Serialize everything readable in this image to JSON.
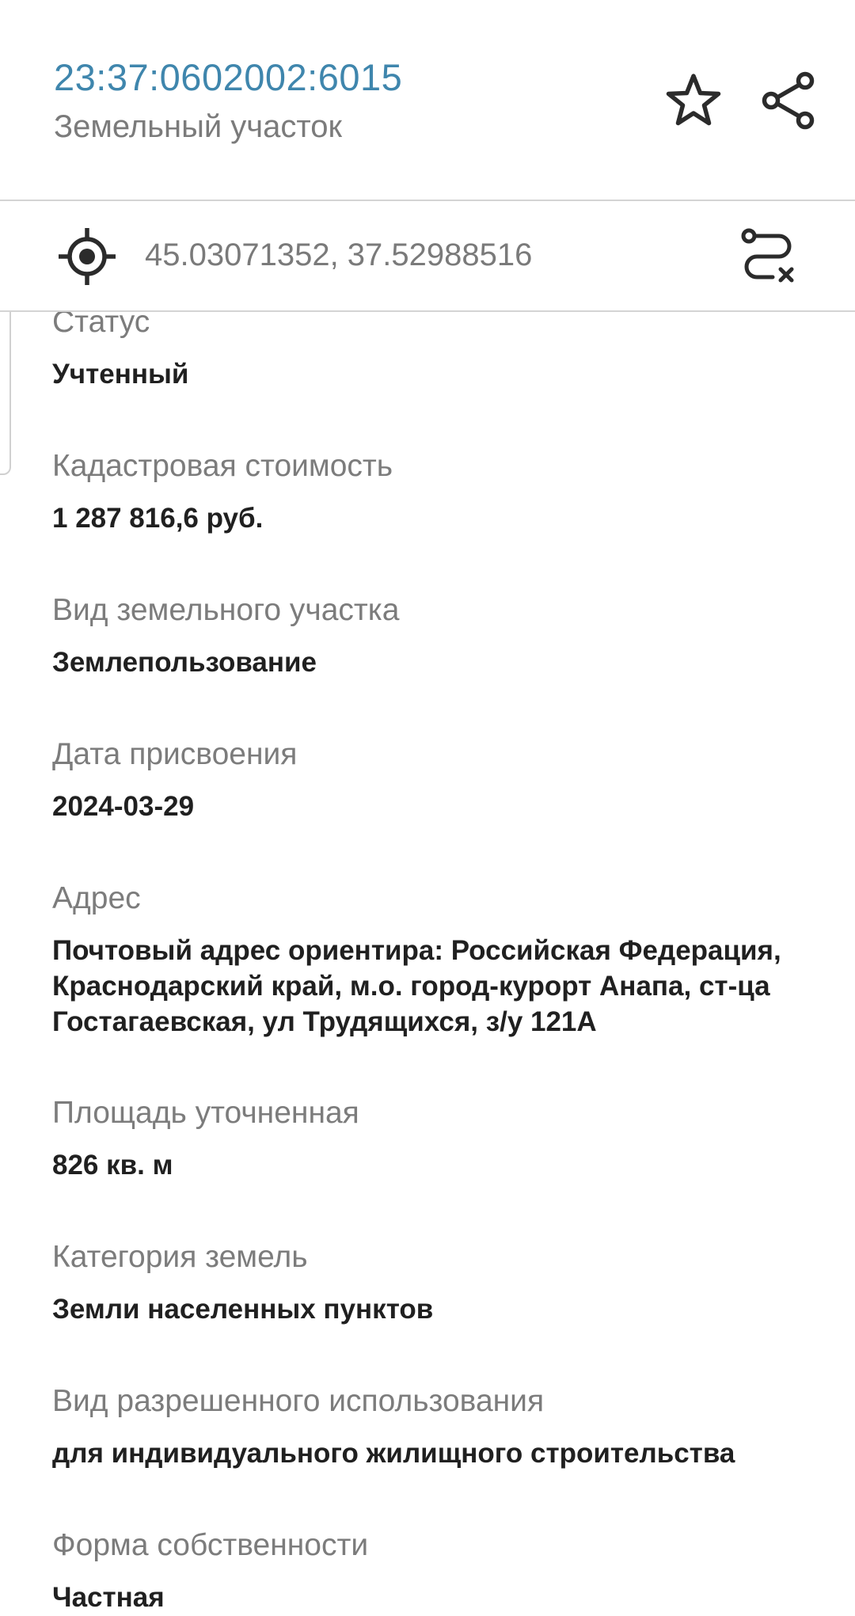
{
  "header": {
    "cadastral_number": "23:37:0602002:6015",
    "object_type": "Земельный участок",
    "favorite_icon": "star-outline-icon",
    "share_icon": "share-icon",
    "accent_color": "#3f86ad"
  },
  "coordinates_bar": {
    "locate_icon": "crosshair-icon",
    "coordinates": "45.03071352, 37.52988516",
    "route_icon": "route-clear-icon"
  },
  "fields": [
    {
      "label": "Статус",
      "value": "Учтенный"
    },
    {
      "label": "Кадастровая стоимость",
      "value": "1 287 816,6 руб."
    },
    {
      "label": "Вид земельного участка",
      "value": "Землепользование"
    },
    {
      "label": "Дата присвоения",
      "value": "2024-03-29"
    },
    {
      "label": "Адрес",
      "value": "Почтовый адрес ориентира: Российская Федерация, Краснодарский край, м.о. город-курорт Анапа, ст-ца Гостагаевская, ул Трудящихся, з/у 121А"
    },
    {
      "label": "Площадь уточненная",
      "value": "826 кв. м"
    },
    {
      "label": "Категория земель",
      "value": "Земли населенных пунктов"
    },
    {
      "label": "Вид разрешенного использования",
      "value": "для индивидуального жилищного строительства"
    },
    {
      "label": "Форма собственности",
      "value": "Частная"
    }
  ]
}
